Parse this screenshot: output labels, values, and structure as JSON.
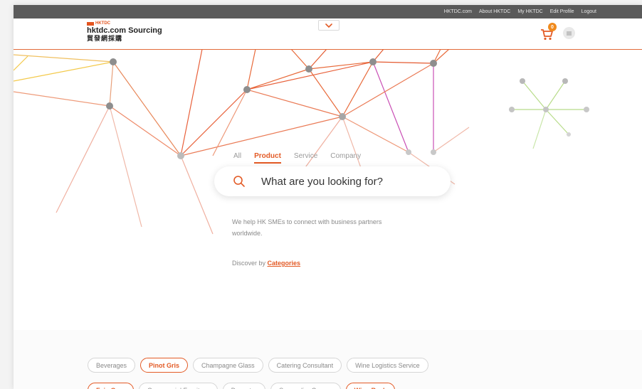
{
  "topbar": {
    "links": [
      "HKTDC.com",
      "About HKTDC",
      "My HKTDC",
      "Edit Profile",
      "Logout"
    ]
  },
  "logo": {
    "brand_small": "HKTDC",
    "title": "hktdc.com Sourcing",
    "title_cn": "貿發網採購"
  },
  "cart": {
    "count": "0"
  },
  "search": {
    "tabs": [
      {
        "label": "All",
        "active": false
      },
      {
        "label": "Product",
        "active": true
      },
      {
        "label": "Service",
        "active": false
      },
      {
        "label": "Company",
        "active": false
      }
    ],
    "placeholder": "What are you looking for?"
  },
  "hero": {
    "tagline": "We help HK SMEs to connect with business partners worldwide.",
    "discover_prefix": "Discover by ",
    "discover_link": "Categories"
  },
  "tags": {
    "row1": [
      {
        "label": "Beverages",
        "active": false
      },
      {
        "label": "Pinot Gris",
        "active": true
      },
      {
        "label": "Champagne Glass",
        "active": false
      },
      {
        "label": "Catering Consultant",
        "active": false
      },
      {
        "label": "Wine Logistics Service",
        "active": false
      }
    ],
    "row2": [
      {
        "label": "Faie Gras",
        "active": true
      },
      {
        "label": "Commercial Furniture",
        "active": false
      },
      {
        "label": "Decanter",
        "active": false
      },
      {
        "label": "Sommelier Course",
        "active": false
      },
      {
        "label": "Wine Rack",
        "active": true
      }
    ]
  },
  "colors": {
    "accent": "#e35a25",
    "topbar": "#5a5a5a",
    "cart_badge": "#f08a1d"
  }
}
